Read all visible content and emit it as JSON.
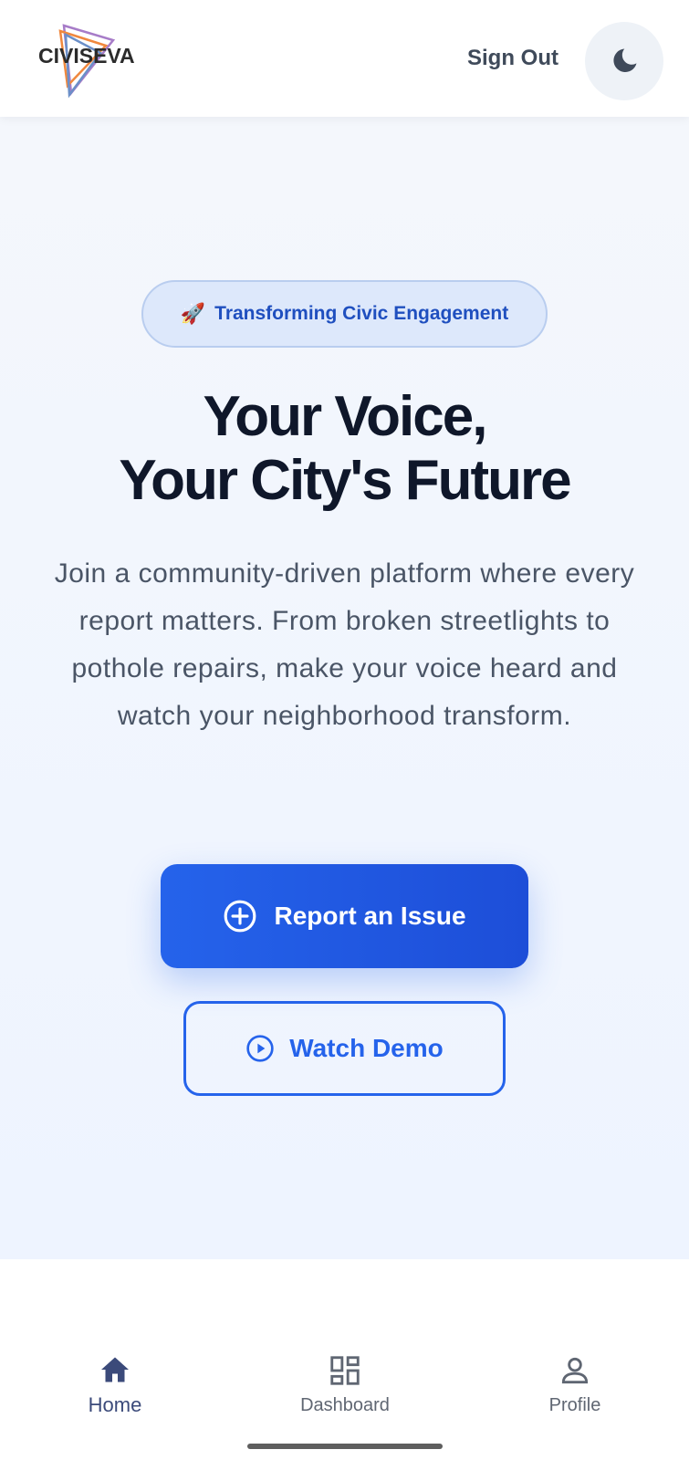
{
  "header": {
    "logo_text": "CIVISEVA",
    "sign_out_label": "Sign Out",
    "theme_toggle_icon": "moon-icon"
  },
  "hero": {
    "badge_emoji": "🚀",
    "badge_text": "Transforming Civic Engagement",
    "title_line1": "Your Voice,",
    "title_line2": "Your City's Future",
    "subtitle": "Join a community-driven platform where every report matters. From broken streetlights to pothole repairs, make your voice heard and watch your neighborhood transform.",
    "primary_button": {
      "label": "Report an Issue",
      "icon": "plus-circle-icon"
    },
    "secondary_button": {
      "label": "Watch Demo",
      "icon": "play-circle-icon"
    }
  },
  "bottom_nav": {
    "items": [
      {
        "label": "Home",
        "icon": "home-icon",
        "active": true
      },
      {
        "label": "Dashboard",
        "icon": "dashboard-icon",
        "active": false
      },
      {
        "label": "Profile",
        "icon": "person-icon",
        "active": false
      }
    ]
  },
  "colors": {
    "primary": "#2563eb",
    "title": "#0f172a",
    "badge_bg": "#dde8fb"
  }
}
